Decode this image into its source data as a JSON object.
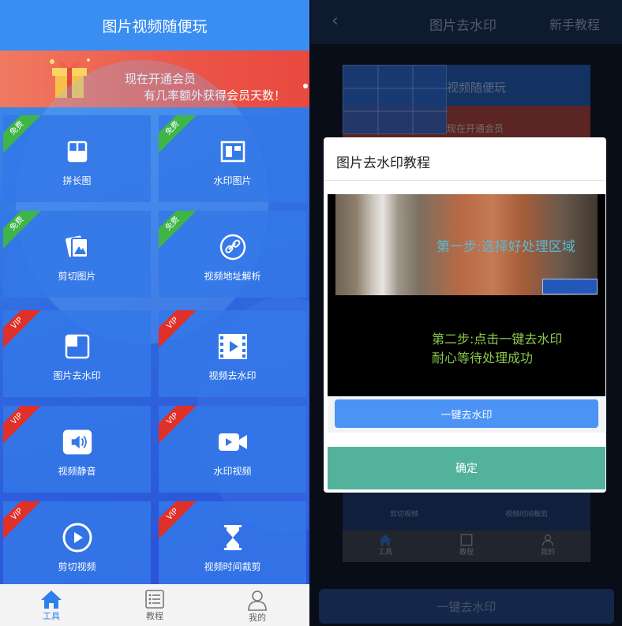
{
  "left": {
    "title": "图片视频随便玩",
    "banner": {
      "line1": "现在开通会员",
      "line2": "有几率额外获得会员天数！"
    },
    "tiles": [
      {
        "label": "拼长图",
        "badge": "免费",
        "icon": "long-image-icon"
      },
      {
        "label": "水印图片",
        "badge": "免费",
        "icon": "watermark-image-icon"
      },
      {
        "label": "剪切图片",
        "badge": "免费",
        "icon": "crop-image-icon"
      },
      {
        "label": "视频地址解析",
        "badge": "免费",
        "icon": "link-icon"
      },
      {
        "label": "图片去水印",
        "badge": "VIP",
        "icon": "remove-image-watermark-icon"
      },
      {
        "label": "视频去水印",
        "badge": "VIP",
        "icon": "remove-video-watermark-icon"
      },
      {
        "label": "视频静音",
        "badge": "VIP",
        "icon": "mute-video-icon"
      },
      {
        "label": "水印视频",
        "badge": "VIP",
        "icon": "video-camera-icon"
      },
      {
        "label": "剪切视频",
        "badge": "VIP",
        "icon": "play-circle-icon"
      },
      {
        "label": "视频时间裁剪",
        "badge": "VIP",
        "icon": "hourglass-icon"
      }
    ],
    "tabs": [
      {
        "label": "工具",
        "icon": "home-icon",
        "active": true
      },
      {
        "label": "教程",
        "icon": "list-icon",
        "active": false
      },
      {
        "label": "我的",
        "icon": "user-icon",
        "active": false
      }
    ]
  },
  "right": {
    "title": "图片去水印",
    "guide": "新手教程",
    "preview": {
      "title": "视频随便玩",
      "banner": "现在开通会员",
      "tiles": [
        "剪切视频",
        "视频时间裁剪"
      ],
      "tabs": [
        "工具",
        "教程",
        "我的"
      ]
    },
    "bottom_button": "一键去水印",
    "modal": {
      "title": "图片去水印教程",
      "step1": "第一步:选择好处理区域",
      "step2_line1": "第二步:点击一键去水印",
      "step2_line2": "耐心等待处理成功",
      "inner_button": "一键去水印",
      "confirm": "确定"
    }
  },
  "colors": {
    "primary": "#3a8ef2",
    "free": "#3fb447",
    "vip": "#e0302a",
    "confirm": "#53b29c"
  }
}
